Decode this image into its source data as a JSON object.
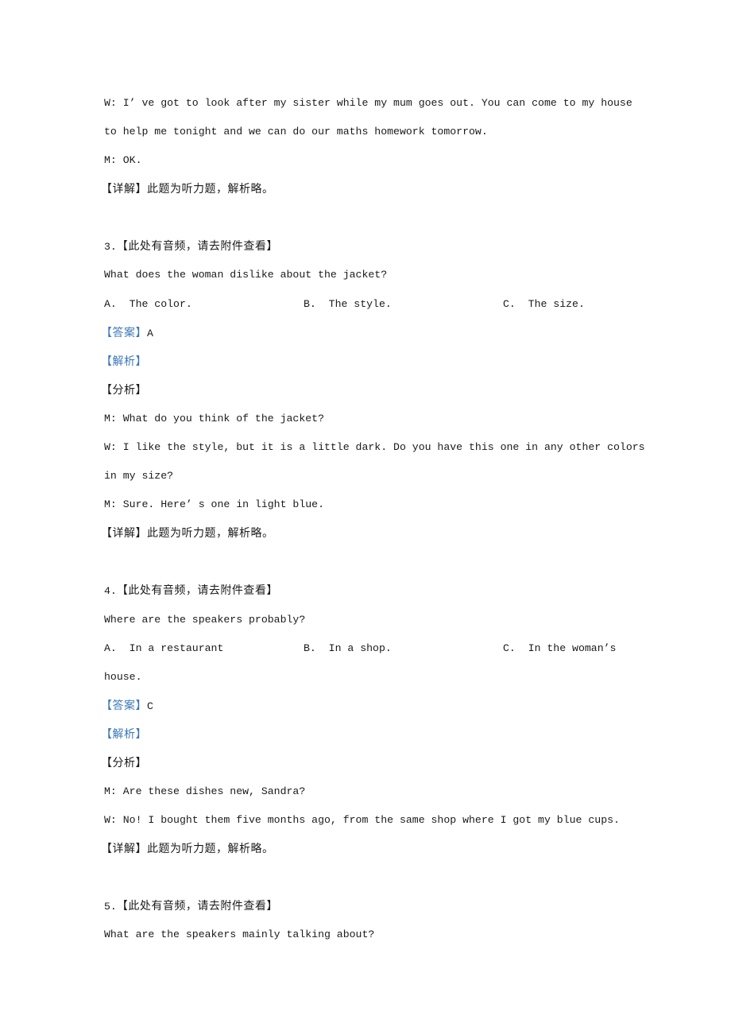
{
  "q2_tail": {
    "dialogue": [
      "W: I’ ve got to look after my sister while my mum goes out. You can come to my house",
      "to help me tonight and we can do our maths homework tomorrow.",
      "M: OK."
    ],
    "detail_label": "【详解】",
    "detail_text": "此题为听力题，解析略。"
  },
  "questions": [
    {
      "number": "3.",
      "audio_note": "【此处有音频，请去附件查看】",
      "question": "What does the woman dislike about the jacket?",
      "options": {
        "a": "A.  The color.",
        "b": "B.  The style.",
        "c": "C.  The size.",
        "c_cont": ""
      },
      "answer_label": "【答案】",
      "answer": "A",
      "analysis_label": "【解析】",
      "breakdown_label": "【分析】",
      "dialogue": [
        "M: What do you think of the jacket?",
        "W: I like the style, but it is a little dark. Do you have this one in any other colors",
        "in my size?",
        "M: Sure. Here’ s one in light blue."
      ],
      "detail_label": "【详解】",
      "detail_text": "此题为听力题，解析略。"
    },
    {
      "number": "4.",
      "audio_note": "【此处有音频，请去附件查看】",
      "question": "Where are the speakers probably?",
      "options": {
        "a": "A.  In a restaurant",
        "b": "B.  In a shop.",
        "c": "C.  In the woman’s",
        "c_cont": "house."
      },
      "answer_label": "【答案】",
      "answer": "C",
      "analysis_label": "【解析】",
      "breakdown_label": "【分析】",
      "dialogue": [
        "M: Are these dishes new, Sandra?",
        "W: No! I bought them five months ago, from the same shop where I got my blue cups."
      ],
      "detail_label": "【详解】",
      "detail_text": "此题为听力题，解析略。"
    },
    {
      "number": "5.",
      "audio_note": "【此处有音频，请去附件查看】",
      "question": "What are the speakers mainly talking about?"
    }
  ],
  "colors": {
    "text": "#1a1a1a",
    "label_blue": "#3a78b8"
  }
}
